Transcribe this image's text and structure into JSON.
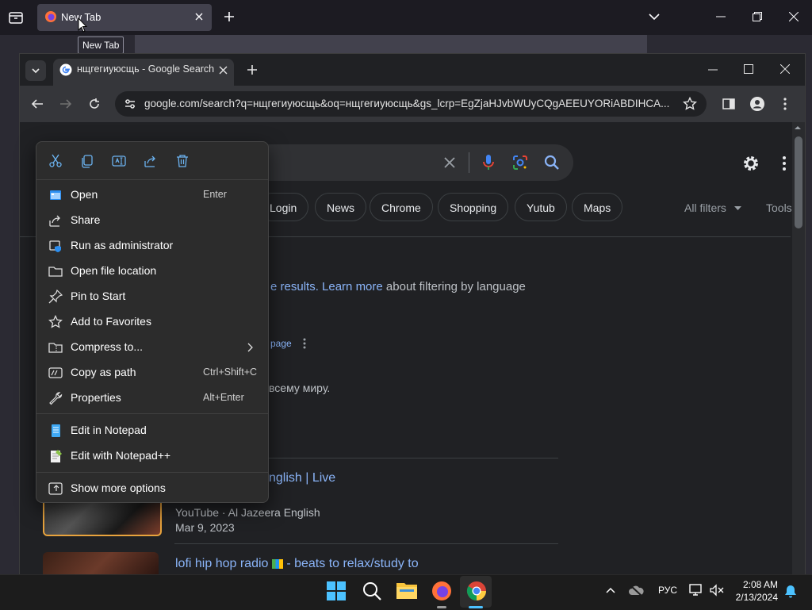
{
  "firefox": {
    "tab_title": "New Tab",
    "tooltip": "New Tab"
  },
  "chrome": {
    "tab_title": "нщгегиуюсщь - Google Search",
    "url": "google.com/search?q=нщгегиуюсщь&oq=нщгегиуюсщь&gs_lcrp=EgZjaHJvbWUyCQgAEEUYORiABDIHCA...",
    "chips": [
      "Login",
      "News",
      "Chrome",
      "Shopping",
      "Yutub",
      "Maps"
    ],
    "all_filters": "All filters",
    "tools": "Tools",
    "filter_note": {
      "partial": "e results.",
      "learn_more": "Learn more",
      "rest": "about filtering by language"
    },
    "page_link": "page",
    "snippet": "всему миру.",
    "results": [
      {
        "title": "nglish | Live",
        "source": "YouTube · Al Jazeera English",
        "date": "Mar 9, 2023"
      },
      {
        "title": "lofi hip hop radio",
        "title_rest": "- beats to relax/study to"
      }
    ]
  },
  "context_menu": {
    "toolbar_icons": [
      "cut-icon",
      "copy-icon",
      "rename-icon",
      "share-icon",
      "delete-icon"
    ],
    "items": [
      {
        "label": "Open",
        "shortcut": "Enter",
        "icon": "open-icon"
      },
      {
        "label": "Share",
        "shortcut": "",
        "icon": "share-icon"
      },
      {
        "label": "Run as administrator",
        "shortcut": "",
        "icon": "shield-icon"
      },
      {
        "label": "Open file location",
        "shortcut": "",
        "icon": "folder-icon"
      },
      {
        "label": "Pin to Start",
        "shortcut": "",
        "icon": "pin-icon"
      },
      {
        "label": "Add to Favorites",
        "shortcut": "",
        "icon": "star-icon"
      },
      {
        "label": "Compress to...",
        "shortcut": "",
        "icon": "zip-icon"
      },
      {
        "label": "Copy as path",
        "shortcut": "Ctrl+Shift+C",
        "icon": "path-icon"
      },
      {
        "label": "Properties",
        "shortcut": "Alt+Enter",
        "icon": "wrench-icon"
      },
      {
        "label": "Edit in Notepad",
        "shortcut": "",
        "icon": "notepad-icon"
      },
      {
        "label": "Edit with Notepad++",
        "shortcut": "",
        "icon": "notepadpp-icon"
      },
      {
        "label": "Show more options",
        "shortcut": "",
        "icon": "more-options-icon"
      }
    ]
  },
  "taskbar": {
    "language": "РУС",
    "time": "2:08 AM",
    "date": "2/13/2024"
  },
  "colors": {
    "link": "#8ab4f8",
    "menu_bg": "#2c2c2c",
    "accent": "#4cc2ff"
  }
}
